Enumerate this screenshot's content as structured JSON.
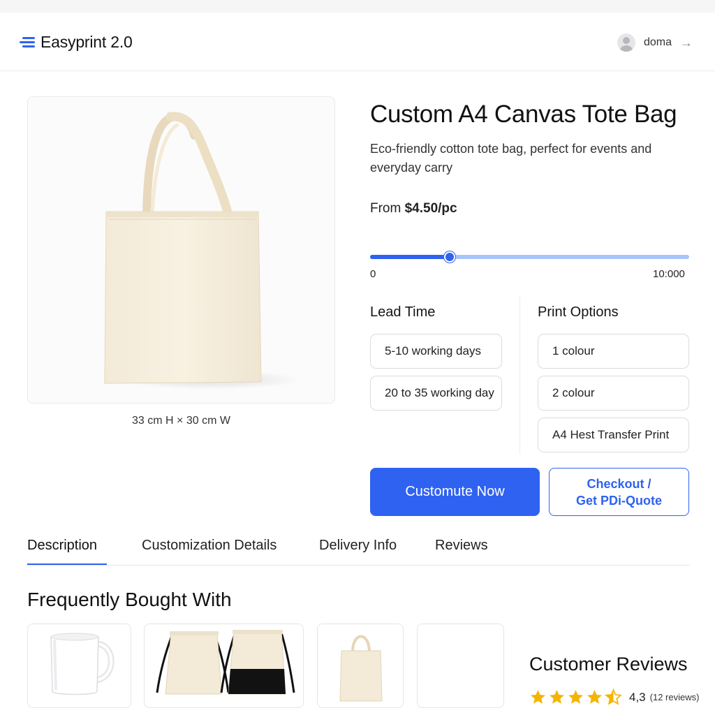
{
  "app": {
    "name": "Easyprint 2.0",
    "brand_color": "#2f62f0"
  },
  "user": {
    "name": "doma"
  },
  "product": {
    "title": "Custom A4 Canvas Tote Bag",
    "description": "Eco-friendly cotton tote bag, perfect for events and everyday carry",
    "price_prefix": "From",
    "price": "$4.50/pc",
    "dimensions": "33 cm H × 30 cm W"
  },
  "quantity_slider": {
    "min_label": "0",
    "max_label": "10:000",
    "level_fraction": 0.25
  },
  "lead_time": {
    "label": "Lead Time",
    "options": [
      "5-10 working days",
      "20 to 35 working day"
    ]
  },
  "print_options": {
    "label": "Print Options",
    "options": [
      "1 colour",
      "2 colour",
      "A4 Hest Transfer Print"
    ]
  },
  "actions": {
    "customize_label": "Customute Now",
    "checkout_line1": "Checkout /",
    "checkout_line2": "Get PDi-Quote"
  },
  "tabs": [
    "Description",
    "Customization Details",
    "Delivery Info",
    "Reviews"
  ],
  "active_tab": "Description",
  "frequently_bought": {
    "title": "Frequently Bought With",
    "items": [
      "mug-image",
      "drawstring-bags-image",
      "tote-bag-image",
      "empty-card"
    ]
  },
  "reviews": {
    "title": "Customer Reviews",
    "rating": "4,3",
    "count": "(12 reviews)",
    "stars_value": 4.5,
    "star_color": "#f5b400"
  }
}
